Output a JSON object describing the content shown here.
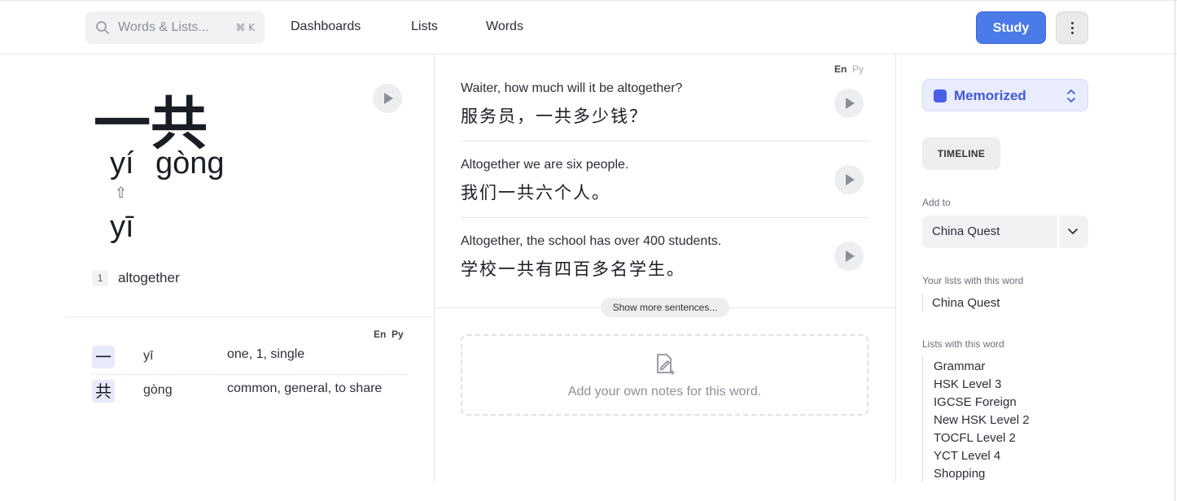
{
  "header": {
    "search_placeholder": "Words & Lists...",
    "search_shortcut": "⌘ K",
    "nav": [
      "Dashboards",
      "Lists",
      "Words"
    ],
    "study_label": "Study"
  },
  "word": {
    "hanzi": "一共",
    "pinyin_1": "yí",
    "pinyin_2": "gòng",
    "tone_change_arrow": "⇧",
    "original_pinyin": "yī",
    "meaning_index": "1",
    "meaning": "altogether"
  },
  "lang_toggle": {
    "en": "En",
    "py": "Py"
  },
  "characters": [
    {
      "char": "一",
      "pinyin": "yī",
      "definition": "one, 1, single"
    },
    {
      "char": "共",
      "pinyin": "gòng",
      "definition": "common, general, to share"
    }
  ],
  "sentences": [
    {
      "en": "Waiter, how much will it be altogether?",
      "zh": "服务员，一共多少钱？"
    },
    {
      "en": "Altogether we are six people.",
      "zh": "我们一共六个人。"
    },
    {
      "en": "Altogether, the school has over 400 students.",
      "zh": "学校一共有四百多名学生。"
    }
  ],
  "show_more_label": "Show more sentences...",
  "notes_placeholder": "Add your own notes for this word.",
  "sidebar": {
    "status": "Memorized",
    "status_color": "#4960e6",
    "timeline_label": "TIMELINE",
    "add_to_label": "Add to",
    "add_to_value": "China Quest",
    "your_lists_label": "Your lists with this word",
    "your_lists": [
      "China Quest"
    ],
    "lists_label": "Lists with this word",
    "lists": [
      "Grammar",
      "HSK Level 3",
      "IGCSE Foreign",
      "New HSK Level 2",
      "TOCFL Level 2",
      "YCT Level 4",
      "Shopping"
    ]
  }
}
